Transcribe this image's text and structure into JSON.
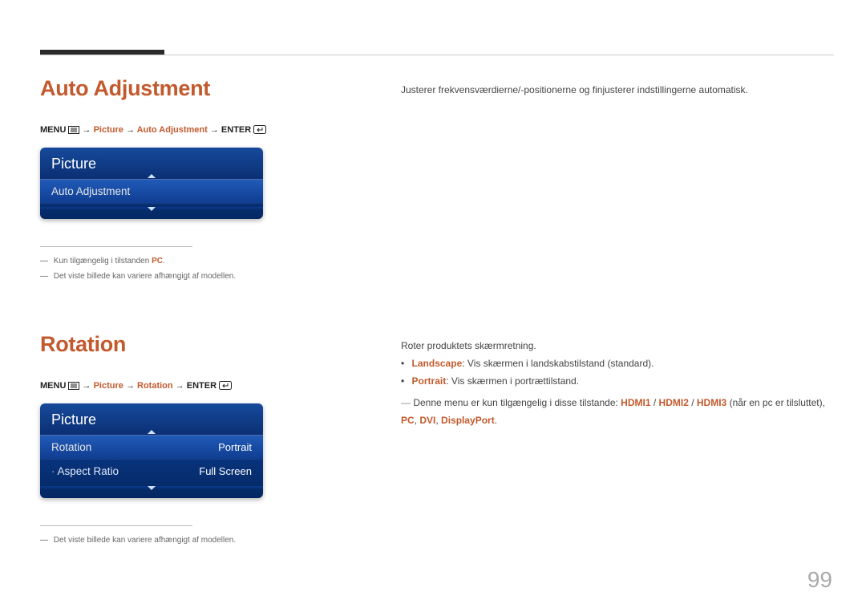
{
  "pageNumber": "99",
  "section1": {
    "heading": "Auto Adjustment",
    "breadcrumb": {
      "menuLabel": "MENU",
      "arrow": " → ",
      "picture": "Picture",
      "item": "Auto Adjustment",
      "enterLabel": "ENTER"
    },
    "osd": {
      "title": "Picture",
      "row1": "Auto Adjustment"
    },
    "footnotes": {
      "n1_prefix": "Kun tilgængelig i tilstanden ",
      "n1_orange": "PC",
      "n1_suffix": ".",
      "n2": "Det viste billede kan variere afhængigt af modellen."
    },
    "rightText": "Justerer frekvensværdierne/-positionerne og finjusterer indstillingerne automatisk."
  },
  "section2": {
    "heading": "Rotation",
    "breadcrumb": {
      "menuLabel": "MENU",
      "arrow": " → ",
      "picture": "Picture",
      "item": "Rotation",
      "enterLabel": "ENTER"
    },
    "osd": {
      "title": "Picture",
      "row1": {
        "label": "Rotation",
        "value": "Portrait"
      },
      "row2": {
        "label": "Aspect Ratio",
        "value": "Full Screen"
      }
    },
    "footnotes": {
      "n1": "Det viste billede kan variere afhængigt af modellen."
    },
    "rightText": {
      "intro": "Roter produktets skærmretning.",
      "b1_label": "Landscape",
      "b1_text": ": Vis skærmen i landskabstilstand (standard).",
      "b2_label": "Portrait",
      "b2_text": ": Vis skærmen i portrættilstand.",
      "note_prefix": "Denne menu er kun tilgængelig i disse tilstande: ",
      "m1": "HDMI1",
      "sep1": " / ",
      "m2": "HDMI2",
      "sep2": " / ",
      "m3": "HDMI3",
      "paren": " (når en pc er tilsluttet), ",
      "m4": "PC",
      "comma1": ", ",
      "m5": "DVI",
      "comma2": ", ",
      "m6": "DisplayPort",
      "end": "."
    }
  }
}
